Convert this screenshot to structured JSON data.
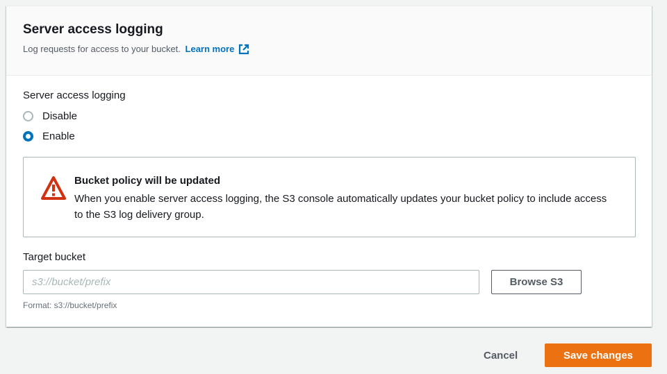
{
  "panel": {
    "title": "Server access logging",
    "description": "Log requests for access to your bucket.",
    "learn_more": "Learn more"
  },
  "logging": {
    "label": "Server access logging",
    "options": [
      {
        "label": "Disable",
        "selected": false
      },
      {
        "label": "Enable",
        "selected": true
      }
    ]
  },
  "alert": {
    "title": "Bucket policy will be updated",
    "body": "When you enable server access logging, the S3 console automatically updates your bucket policy to include access to the S3 log delivery group."
  },
  "target": {
    "label": "Target bucket",
    "placeholder": "s3://bucket/prefix",
    "value": "",
    "browse": "Browse S3",
    "hint": "Format: s3://bucket/prefix"
  },
  "footer": {
    "cancel": "Cancel",
    "save": "Save changes"
  },
  "colors": {
    "accent": "#0073bb",
    "primary": "#ec7211",
    "warning": "#d13212"
  }
}
